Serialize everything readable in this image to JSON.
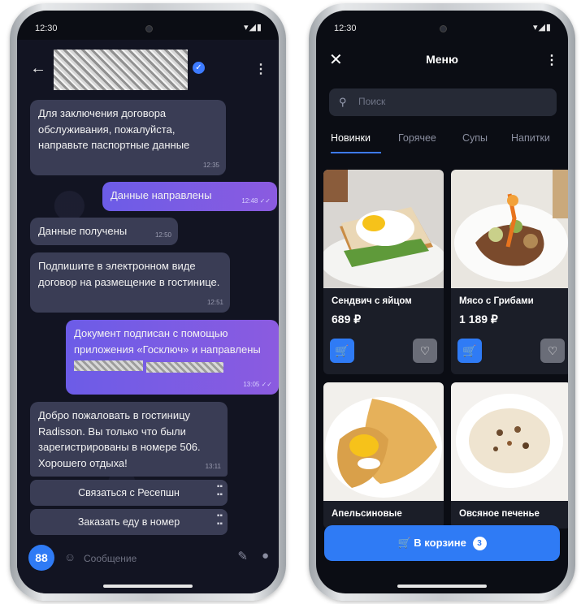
{
  "status": {
    "time": "12:30",
    "icons": "▾◢▮"
  },
  "chat": {
    "messages": [
      {
        "text": "Для заключения договора обслуживания, пожалуйста, направьте паспортные данные",
        "time": "12:35"
      },
      {
        "text": "Данные направлены",
        "time": "12:48 ✓✓"
      },
      {
        "text": "Данные получены",
        "time": "12:50"
      },
      {
        "text": "Подпишите в электронном виде договор на размещение в гостинице.",
        "time": "12:51"
      },
      {
        "text": "Документ подписан с помощью приложения «Госключ» и направлены",
        "time": "13:05 ✓✓"
      },
      {
        "text": "Добро пожаловать в гостиницу Radisson. Вы только что были зарегистрированы в номере 506. Хорошего отдыха!",
        "time": "13:11"
      }
    ],
    "actions": [
      {
        "label": "Связаться с Ресепшн"
      },
      {
        "label": "Заказать еду в номер"
      }
    ],
    "input_placeholder": "Сообщение"
  },
  "menu": {
    "title": "Меню",
    "search_placeholder": "Поиск",
    "tabs": [
      "Новинки",
      "Горячее",
      "Супы",
      "Напитки"
    ],
    "items": [
      {
        "name": "Сендвич с яйцом",
        "price": "689 ₽"
      },
      {
        "name": "Мясо с Грибами",
        "price": "1 189 ₽"
      },
      {
        "name": "Апельсиновые",
        "price": ""
      },
      {
        "name": "Овсяное печенье",
        "price": ""
      }
    ],
    "cart_label": "В корзине",
    "cart_count": "3"
  },
  "colors": {
    "accent": "#2f7bf5",
    "bubble_in": "#3a3d55",
    "bubble_out": "#7b5ce6",
    "background": "#0b0d14"
  }
}
